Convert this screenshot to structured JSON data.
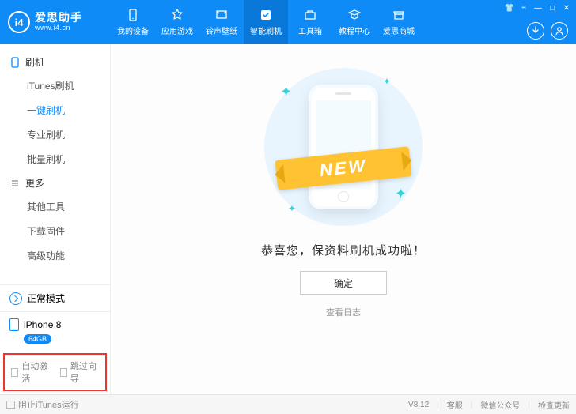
{
  "brand": {
    "name": "爱思助手",
    "url": "www.i4.cn",
    "logo_text": "i4"
  },
  "tabs": [
    {
      "id": "device",
      "label": "我的设备"
    },
    {
      "id": "apps",
      "label": "应用游戏"
    },
    {
      "id": "ring",
      "label": "铃声壁纸"
    },
    {
      "id": "flash",
      "label": "智能刷机"
    },
    {
      "id": "toolbox",
      "label": "工具箱"
    },
    {
      "id": "tutorial",
      "label": "教程中心"
    },
    {
      "id": "shop",
      "label": "爱思商城"
    }
  ],
  "active_tab": "flash",
  "sidebar": {
    "groups": [
      {
        "title": "刷机",
        "icon": "phone",
        "items": [
          {
            "id": "itunes",
            "label": "iTunes刷机"
          },
          {
            "id": "onekey",
            "label": "一键刷机"
          },
          {
            "id": "pro",
            "label": "专业刷机"
          },
          {
            "id": "batch",
            "label": "批量刷机"
          }
        ]
      },
      {
        "title": "更多",
        "icon": "more",
        "items": [
          {
            "id": "other",
            "label": "其他工具"
          },
          {
            "id": "fw",
            "label": "下载固件"
          },
          {
            "id": "adv",
            "label": "高级功能"
          }
        ]
      }
    ],
    "active_sub": "onekey",
    "mode_label": "正常模式",
    "device": {
      "name": "iPhone 8",
      "storage": "64GB"
    },
    "checks": {
      "auto_activate": "自动激活",
      "skip_guide": "跳过向导"
    }
  },
  "main": {
    "ribbon": "NEW",
    "message": "恭喜您，保资料刷机成功啦！",
    "ok": "确定",
    "log": "查看日志"
  },
  "footer": {
    "block_itunes": "阻止iTunes运行",
    "version": "V8.12",
    "service": "客服",
    "wechat": "微信公众号",
    "update": "检查更新"
  }
}
